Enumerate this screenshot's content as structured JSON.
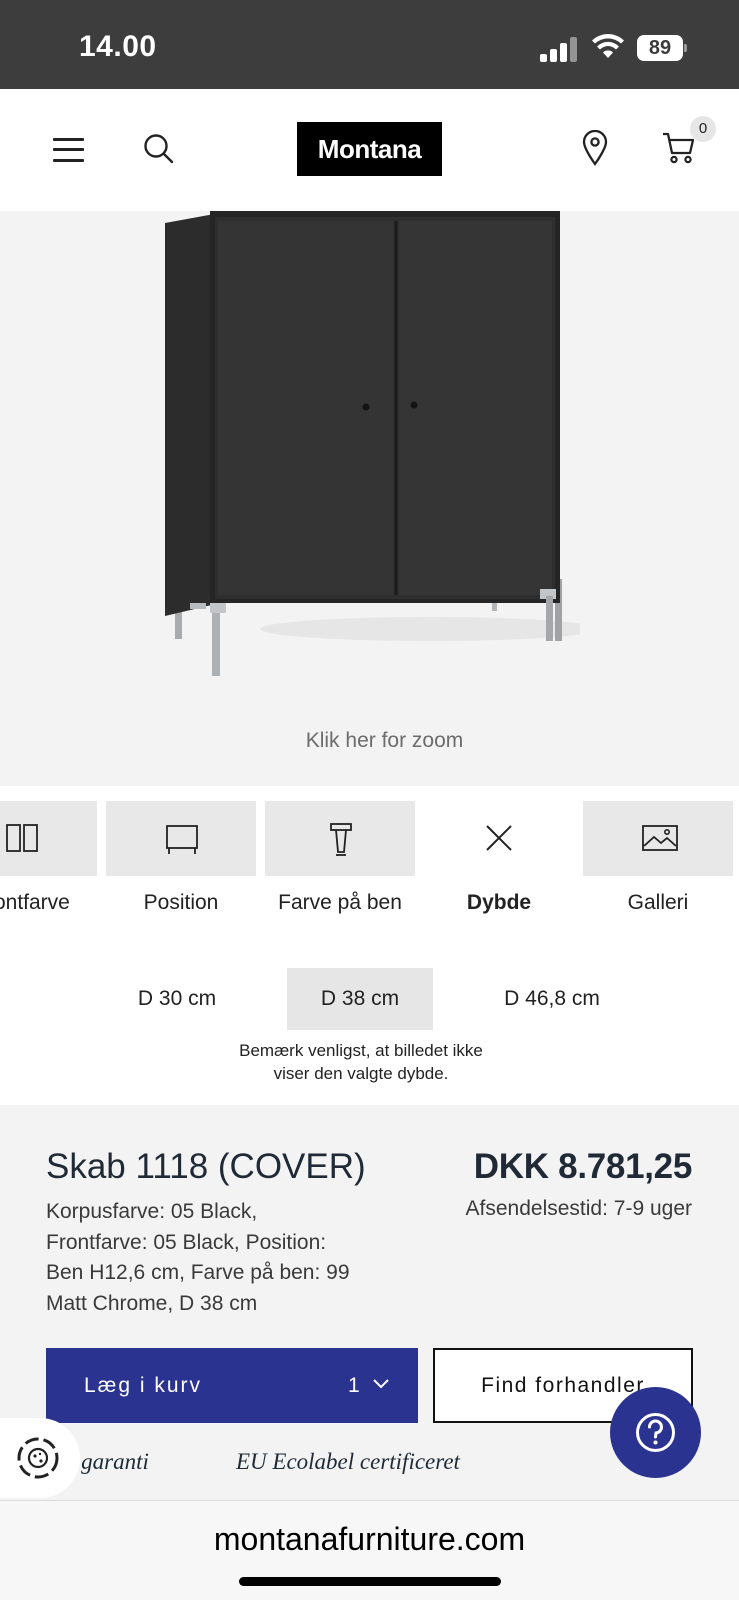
{
  "status_bar": {
    "time": "14.00",
    "battery": "89"
  },
  "header": {
    "logo": "Montana",
    "cart_count": "0",
    "icons": [
      "menu-icon",
      "search-icon",
      "location-pin-icon",
      "cart-icon"
    ]
  },
  "hero": {
    "zoom_text": "Klik her for zoom",
    "image": "black-two-door-cabinet-on-chrome-legs"
  },
  "tabs": [
    {
      "label": "Frontfarve",
      "icon": "front-color-icon",
      "active": false
    },
    {
      "label": "Position",
      "icon": "position-icon",
      "active": false
    },
    {
      "label": "Farve på ben",
      "icon": "leg-color-icon",
      "active": false
    },
    {
      "label": "Dybde",
      "icon": "close-icon",
      "active": true
    },
    {
      "label": "Galleri",
      "icon": "gallery-icon",
      "active": false
    }
  ],
  "depth": {
    "options": [
      "D 30 cm",
      "D 38 cm",
      "D 46,8 cm"
    ],
    "selected": "D 38 cm",
    "note_line1": "Bemærk venligst, at billedet ikke",
    "note_line2": "viser den valgte dybde."
  },
  "product": {
    "title": "Skab 1118 (COVER)",
    "price": "DKK 8.781,25",
    "shipping": "Afsendelsestid: 7-9 uger",
    "desc_lines": [
      "Korpusfarve: 05 Black,",
      "Frontfarve: 05 Black, Position:",
      "Ben H12,6 cm, Farve på ben: 99",
      "Matt Chrome, D 38 cm"
    ],
    "add_to_cart": "Læg i kurv",
    "quantity": "1",
    "find_dealer": "Find forhandler",
    "badge_warranty": "års garanti",
    "badge_eco": "EU Ecolabel certificeret"
  },
  "browser": {
    "url": "montanafurniture.com"
  },
  "colors": {
    "accent": "#2b3390",
    "status_bar": "#3d3d3d",
    "hero_bg": "#f3f3f3"
  }
}
